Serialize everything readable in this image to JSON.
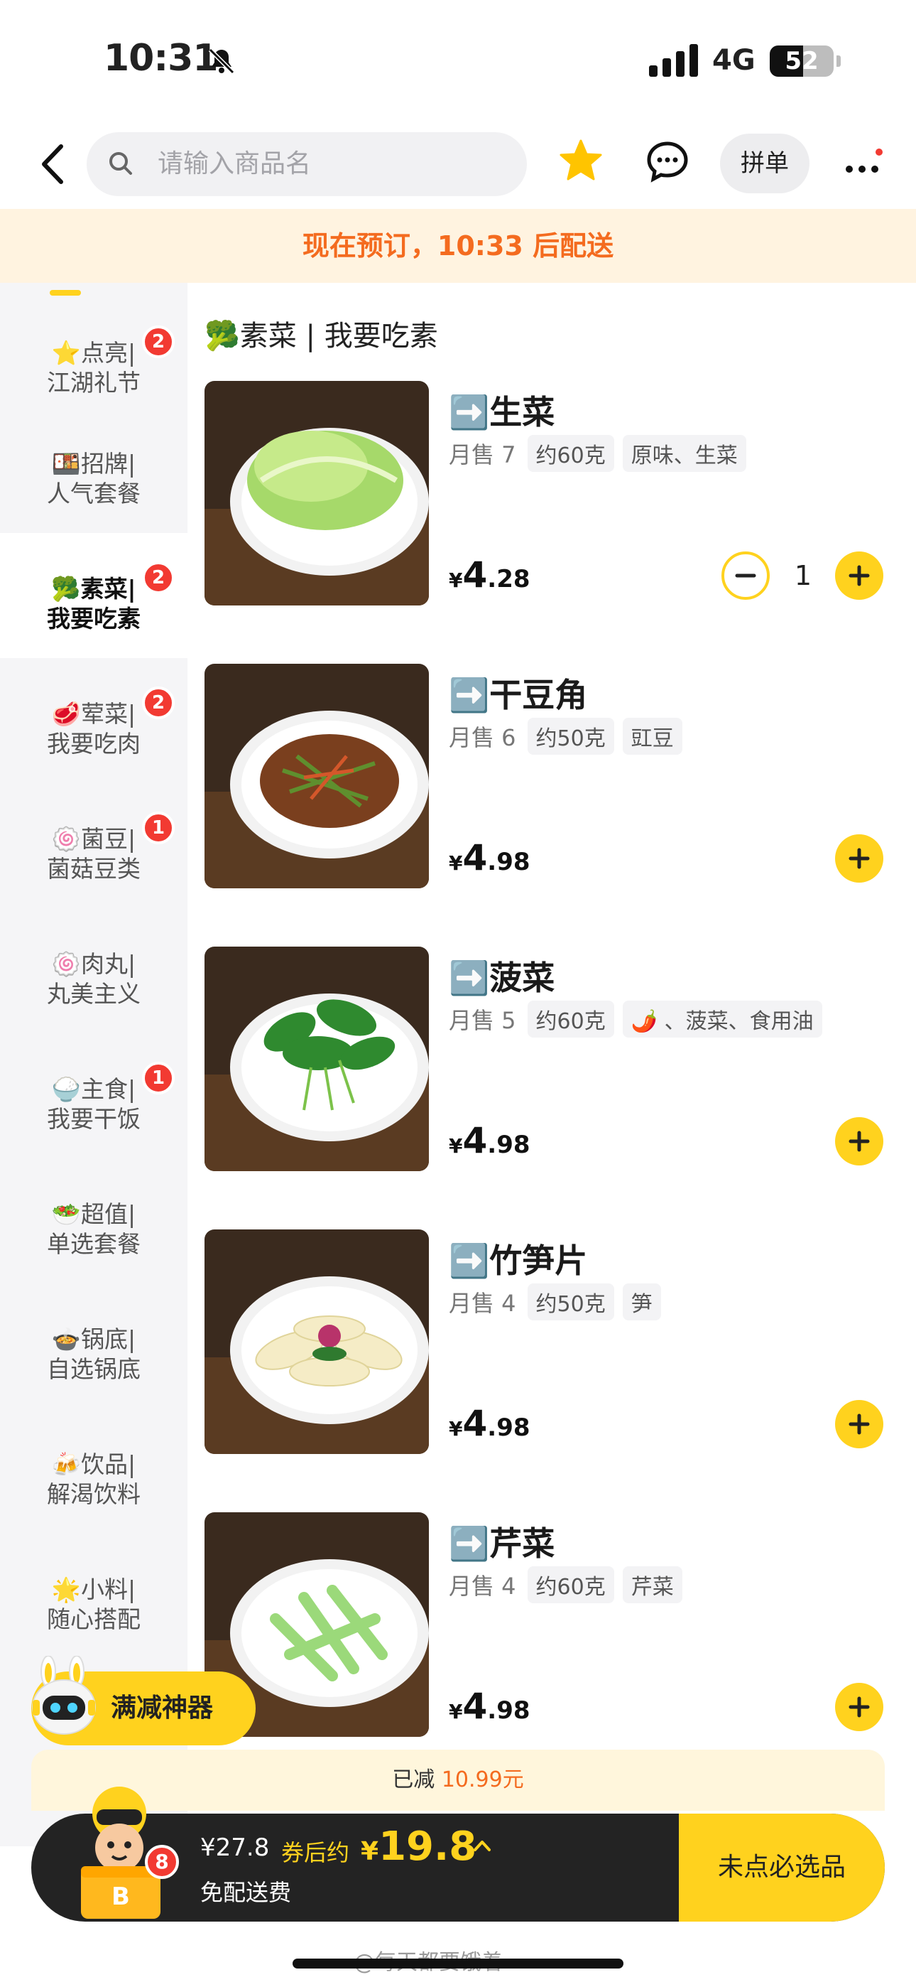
{
  "status": {
    "time": "10:31",
    "network": "4G",
    "battery": "52",
    "battery_level": 0.52
  },
  "nav": {
    "search_placeholder": "请输入商品名",
    "group_order_label": "拼单"
  },
  "banner": {
    "text": "现在预订，10:33 后配送"
  },
  "sidebar": {
    "items": [
      {
        "emoji": "⭐",
        "line1": "点亮|",
        "line2": "江湖礼节",
        "badge": "2",
        "active": false
      },
      {
        "emoji": "🍱",
        "line1": "招牌|",
        "line2": "人气套餐",
        "badge": "",
        "active": false
      },
      {
        "emoji": "🥦",
        "line1": "素菜|",
        "line2": "我要吃素",
        "badge": "2",
        "active": true
      },
      {
        "emoji": "🥩",
        "line1": "荤菜|",
        "line2": "我要吃肉",
        "badge": "2",
        "active": false
      },
      {
        "emoji": "🍥",
        "line1": "菌豆|",
        "line2": "菌菇豆类",
        "badge": "1",
        "active": false
      },
      {
        "emoji": "🍥",
        "line1": "肉丸|",
        "line2": "丸美主义",
        "badge": "",
        "active": false
      },
      {
        "emoji": "🍚",
        "line1": "主食|",
        "line2": "我要干饭",
        "badge": "1",
        "active": false
      },
      {
        "emoji": "🥗",
        "line1": "超值|",
        "line2": "单选套餐",
        "badge": "",
        "active": false
      },
      {
        "emoji": "🍲",
        "line1": "锅底|",
        "line2": "自选锅底",
        "badge": "",
        "active": false
      },
      {
        "emoji": "🍻",
        "line1": "饮品|",
        "line2": "解渴饮料",
        "badge": "",
        "active": false
      },
      {
        "emoji": "🌟",
        "line1": "小料|",
        "line2": "随心搭配",
        "badge": "",
        "active": false
      }
    ]
  },
  "section": {
    "title": "🥦素菜 | 我要吃素"
  },
  "products": [
    {
      "name": "➡️生菜",
      "sold": "月售 7",
      "tags": [
        "约60克",
        "原味、生菜"
      ],
      "price_int": "4",
      "price_dec": ".28",
      "qty": "1",
      "photo": "lettuce"
    },
    {
      "name": "➡️干豆角",
      "sold": "月售 6",
      "tags": [
        "约50克",
        "豇豆"
      ],
      "price_int": "4",
      "price_dec": ".98",
      "qty": "",
      "photo": "beans"
    },
    {
      "name": "➡️菠菜",
      "sold": "月售 5",
      "tags": [
        "约60克",
        "🌶️ 、菠菜、食用油"
      ],
      "price_int": "4",
      "price_dec": ".98",
      "qty": "",
      "photo": "spinach"
    },
    {
      "name": "➡️竹笋片",
      "sold": "月售 4",
      "tags": [
        "约50克",
        "笋"
      ],
      "price_int": "4",
      "price_dec": ".98",
      "qty": "",
      "photo": "bamboo"
    },
    {
      "name": "➡️芹菜",
      "sold": "月售 4",
      "tags": [
        "约60克",
        "芹菜"
      ],
      "price_int": "4",
      "price_dec": ".98",
      "qty": "",
      "photo": "celery"
    }
  ],
  "currency": "¥",
  "promo": {
    "label": "满减神器"
  },
  "saved": {
    "prefix": "已减",
    "amount": "10.99元"
  },
  "cart": {
    "count": "8",
    "original": "¥27.8",
    "coupon_label": "券后约",
    "final_currency": "¥",
    "final_value": "19.8",
    "delivery": "免配送费",
    "checkout_label": "未点必选品"
  },
  "watermark": "@每天都要饿着",
  "colors": {
    "accent": "#ffd21e",
    "banner_text": "#f46b1f",
    "badge": "#f23a32",
    "cart_bar": "#232323"
  }
}
